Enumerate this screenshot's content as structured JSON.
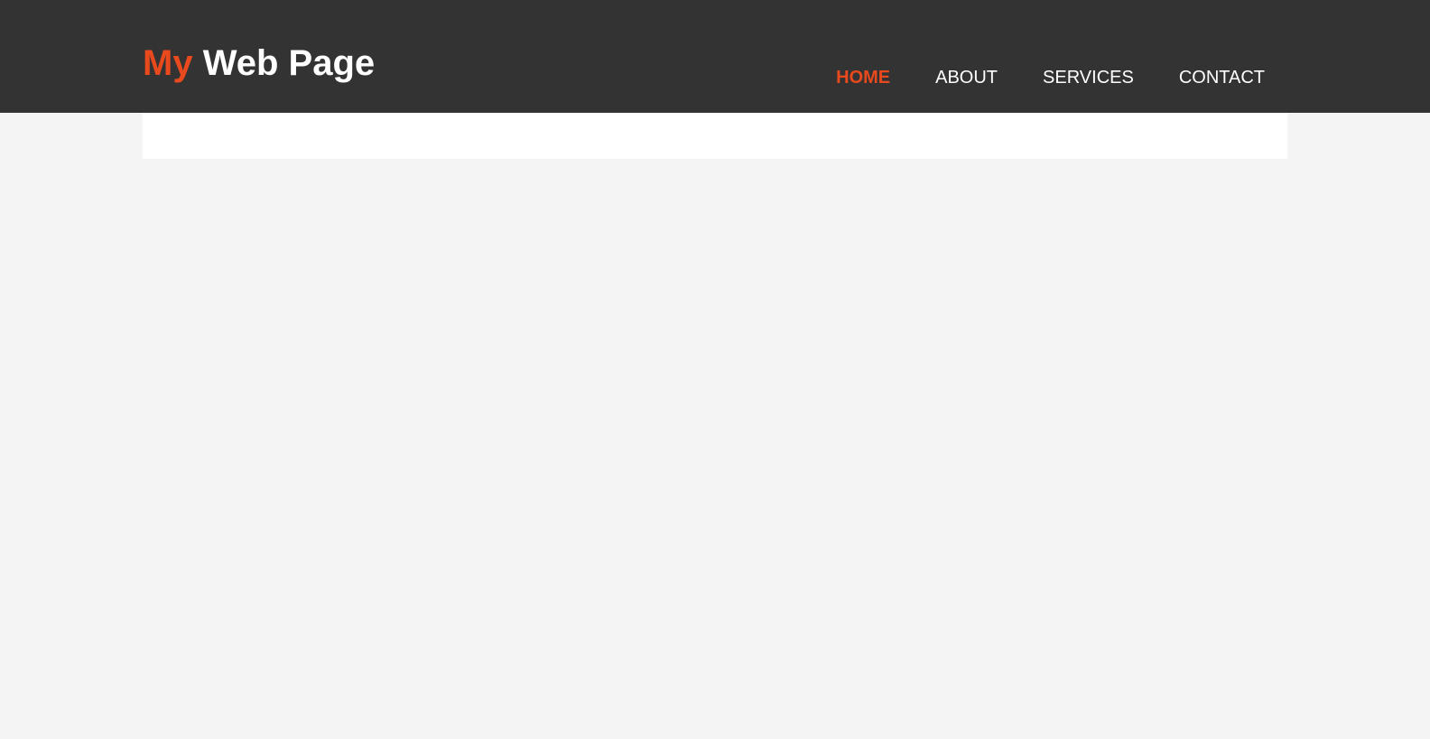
{
  "header": {
    "brand": {
      "highlight": "My",
      "rest": "Web Page"
    },
    "nav": [
      {
        "label": "HOME",
        "current": true
      },
      {
        "label": "ABOUT",
        "current": false
      },
      {
        "label": "SERVICES",
        "current": false
      },
      {
        "label": "CONTACT",
        "current": false
      }
    ]
  },
  "colors": {
    "header_bg": "#333333",
    "accent": "#e8491d",
    "page_bg": "#f4f4f4",
    "content_bg": "#ffffff",
    "nav_text": "#ffffff"
  }
}
